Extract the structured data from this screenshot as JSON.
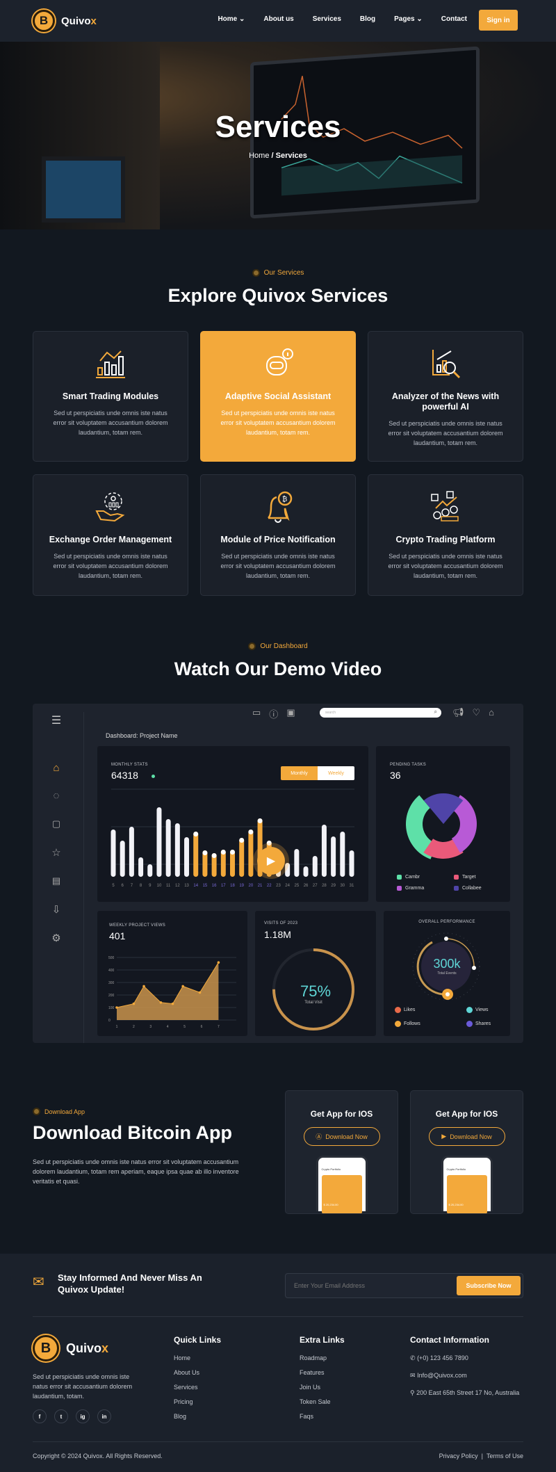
{
  "nav": {
    "brand_main": "Quivo",
    "brand_accent": "x",
    "logo_letter": "B",
    "links": [
      "Home",
      "About us",
      "Services",
      "Blog",
      "Pages",
      "Contact"
    ],
    "signin": "Sign in"
  },
  "hero": {
    "title": "Services",
    "crumb_home": "Home",
    "crumb_sep": "/",
    "crumb_current": "Services"
  },
  "services": {
    "eyebrow": "Our Services",
    "title": "Explore Quivox Services",
    "cards": [
      {
        "title": "Smart Trading Modules",
        "text": "Sed ut perspiciatis unde omnis iste natus error sit voluptatem accusantium dolorem laudantium, totam rem.",
        "icon": "chart-growth-icon"
      },
      {
        "title": "Adaptive Social Assistant",
        "text": "Sed ut perspiciatis unde omnis iste natus error sit voluptatem accusantium dolorem laudantium, totam rem.",
        "icon": "robot-assistant-icon"
      },
      {
        "title": "Analyzer of the News with powerful AI",
        "text": "Sed ut perspiciatis unde omnis iste natus error sit voluptatem accusantium dolorem laudantium, totam rem.",
        "icon": "chart-magnifier-icon"
      },
      {
        "title": "Exchange Order Management",
        "text": "Sed ut perspiciatis unde omnis iste natus error sit voluptatem accusantium dolorem laudantium, totam rem.",
        "icon": "hand-gear-icon"
      },
      {
        "title": "Module of Price Notification",
        "text": "Sed ut perspiciatis unde omnis iste natus error sit voluptatem accusantium dolorem laudantium, totam rem.",
        "icon": "bell-bitcoin-icon"
      },
      {
        "title": "Crypto Trading Platform",
        "text": "Sed ut perspiciatis unde omnis iste natus error sit voluptatem accusantium dolorem laudantium, totam rem.",
        "icon": "coins-chart-icon"
      }
    ]
  },
  "demo": {
    "eyebrow": "Our Dashboard",
    "title": "Watch Our Demo Video",
    "dashboard": {
      "search_placeholder": "search",
      "heading": "Dashboard: Project Name",
      "monthly": {
        "label": "MONTHLY STATS",
        "value": "64318",
        "tab_monthly": "Monthly",
        "tab_weekly": "Weekly"
      },
      "pending": {
        "label": "PENDING TASKS",
        "value": "36",
        "legend": [
          "Cambr",
          "Target",
          "Gramma",
          "Collabee"
        ]
      },
      "weekly": {
        "label": "WEEKLY PROJECT VIEWS",
        "value": "401"
      },
      "visits": {
        "label": "VISITS OF 2023",
        "value": "1.18M",
        "percent": "75%",
        "sub": "Total Visit"
      },
      "performance": {
        "label": "OVERALL PERFORMANCE",
        "value": "300k",
        "sub": "Total Events",
        "legend": [
          "Likes",
          "Views",
          "Follows",
          "Shares"
        ]
      }
    }
  },
  "chart_data": [
    {
      "type": "bar",
      "title": "MONTHLY STATS",
      "categories": [
        "5",
        "6",
        "7",
        "8",
        "9",
        "10",
        "11",
        "12",
        "13",
        "14",
        "15",
        "16",
        "17",
        "18",
        "19",
        "20",
        "21",
        "22",
        "23",
        "24",
        "25",
        "26",
        "27",
        "28",
        "29",
        "30",
        "31"
      ],
      "values": [
        68,
        52,
        72,
        28,
        18,
        100,
        83,
        77,
        57,
        65,
        38,
        34,
        39,
        39,
        56,
        68,
        84,
        52,
        25,
        20,
        40,
        15,
        30,
        75,
        58,
        65,
        38
      ],
      "highlighted": [
        "14",
        "15",
        "16",
        "17",
        "18",
        "19",
        "20",
        "21",
        "22"
      ],
      "colors": {
        "normal": "#f2f2f7",
        "highlight": "#f3a93b"
      }
    },
    {
      "type": "pie",
      "title": "PENDING TASKS",
      "series": [
        {
          "name": "Cambr",
          "value": 40,
          "color": "#5ee0a8"
        },
        {
          "name": "Target",
          "value": 12,
          "color": "#ea5a7a"
        },
        {
          "name": "Gramma",
          "value": 30,
          "color": "#b85ad6"
        },
        {
          "name": "Collabee",
          "value": 18,
          "color": "#4f44a8"
        }
      ]
    },
    {
      "type": "area",
      "title": "WEEKLY PROJECT VIEWS",
      "x": [
        1,
        2,
        2.6,
        3.6,
        4.3,
        4.9,
        5.9,
        7
      ],
      "y": [
        100,
        130,
        270,
        140,
        130,
        270,
        220,
        460
      ],
      "xticks": [
        "1",
        "2",
        "3",
        "4",
        "5",
        "6",
        "7"
      ],
      "yticks": [
        "0",
        "100",
        "200",
        "300",
        "400",
        "500"
      ],
      "ylim": [
        0,
        500
      ],
      "color": "#f3a93b"
    },
    {
      "type": "gauge",
      "title": "VISITS OF 2023",
      "value": 75,
      "unit": "%"
    }
  ],
  "download": {
    "eyebrow": "Download App",
    "title": "Download Bitcoin App",
    "text": "Sed ut perspiciatis unde omnis iste natus error sit voluptatem accusantium dolorem laudantium, totam rem aperiam, eaque ipsa quae ab illo inventore veritatis et quasi.",
    "cards": [
      {
        "title": "Get App for IOS",
        "button": "Download Now",
        "phone_title": "Crypto Portfolio",
        "phone_price": "$ 20,234.00"
      },
      {
        "title": "Get App for IOS",
        "button": "Download Now",
        "phone_title": "Crypto Portfolio",
        "phone_price": "$ 20,234.00"
      }
    ]
  },
  "newsletter": {
    "title_line1": "Stay Informed And Never Miss An",
    "title_line2": "Quivox Update!",
    "placeholder": "Enter Your Email Address",
    "button": "Subscribe Now"
  },
  "footer": {
    "about": "Sed ut perspiciatis unde omnis iste natus error sit accusantium dolorem laudantium, totam.",
    "quick_title": "Quick Links",
    "quick": [
      "Home",
      "About Us",
      "Services",
      "Pricing",
      "Blog"
    ],
    "extra_title": "Extra Links",
    "extra": [
      "Roadmap",
      "Features",
      "Join Us",
      "Token Sale",
      "Faqs"
    ],
    "contact_title": "Contact Information",
    "phone": "(+0) 123 456 7890",
    "email": "Info@Quivox.com",
    "address": "200 East 65th Street 17 No, Australia",
    "social": [
      "f",
      "t",
      "ig",
      "in"
    ],
    "copyright": "Copyright © 2024 Quivox. All Rights Reserved.",
    "privacy": "Privacy Policy",
    "sep": "|",
    "terms": "Terms of Use"
  },
  "colors": {
    "accent": "#f3a93b",
    "bg": "#121820",
    "panel": "#1b2029"
  }
}
